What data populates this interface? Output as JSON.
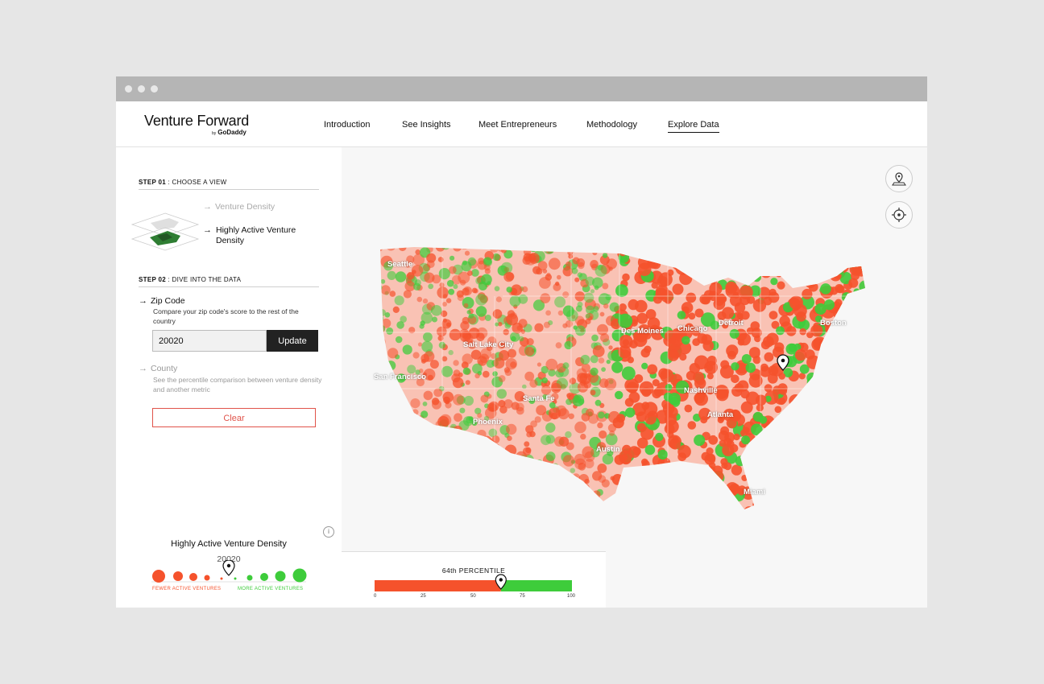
{
  "app": {
    "logo_main": "Venture Forward",
    "logo_by": "by",
    "logo_brand": "GoDaddy"
  },
  "nav": [
    {
      "label": "Introduction"
    },
    {
      "label": "See Insights"
    },
    {
      "label": "Meet Entrepreneurs"
    },
    {
      "label": "Methodology"
    },
    {
      "label": "Explore Data"
    }
  ],
  "step1": {
    "label_strong": "STEP 01",
    "label_rest": " : CHOOSE A VIEW",
    "options": [
      {
        "label": "Venture Density"
      },
      {
        "label": "Highly Active Venture Density"
      }
    ]
  },
  "step2": {
    "label_strong": "STEP 02",
    "label_rest": " : DIVE INTO THE DATA",
    "zip": {
      "title": "Zip Code",
      "desc": "Compare your zip code's score to the rest of the country",
      "value": "20020",
      "button": "Update"
    },
    "county": {
      "title": "County",
      "desc": "See the percentile comparison between venture density and another metric"
    },
    "clear": "Clear"
  },
  "legend": {
    "title": "Highly Active Venture Density",
    "zip": "20020",
    "fewer": "FEWER ACTIVE VENTURES",
    "more": "MORE ACTIVE VENTURES",
    "info": "i"
  },
  "cities": [
    "Seattle",
    "Salt Lake City",
    "San Francisco",
    "Santa Fe",
    "Phoenix",
    "Des Moines",
    "Chicago",
    "Detroit",
    "Boston",
    "Nashville",
    "Atlanta",
    "Austin",
    "Miami"
  ],
  "percentile": {
    "title": "64th PERCENTILE",
    "value": 64,
    "ticks": [
      "0",
      "25",
      "50",
      "75",
      "100"
    ]
  },
  "colors": {
    "low": "#f5522c",
    "high": "#3ecc3b",
    "clear_border": "#e0534a"
  }
}
